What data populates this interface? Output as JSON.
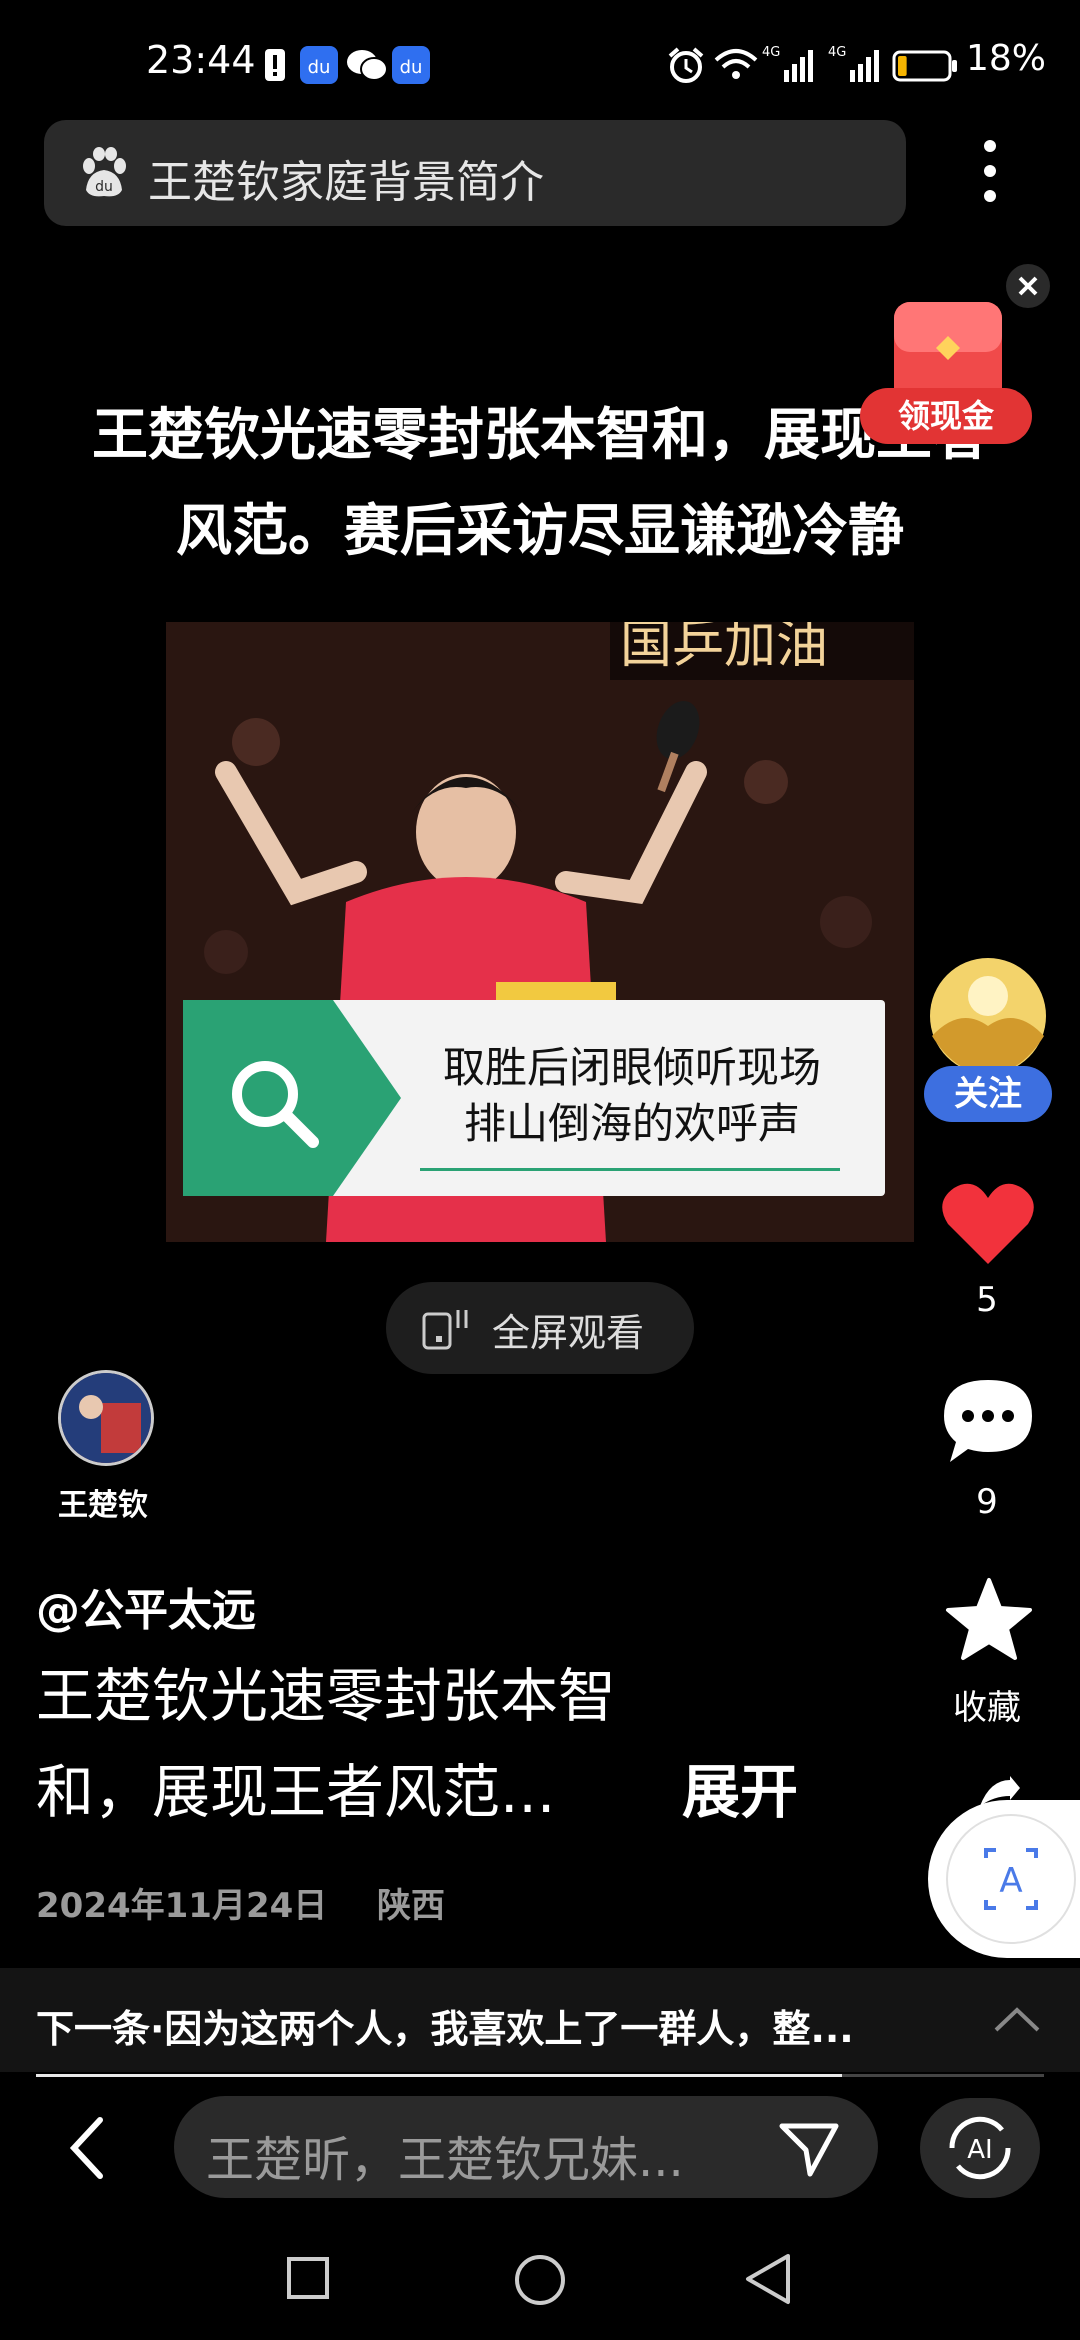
{
  "status_bar": {
    "time": "23:44",
    "battery_percent": "18%",
    "battery_level": 0.18,
    "icons": [
      "alert-icon",
      "baidu-app-icon",
      "wechat-icon",
      "baidu-app-icon",
      "alarm-icon",
      "wifi-icon",
      "signal-4g-icon",
      "signal-4g-icon",
      "battery-icon"
    ]
  },
  "search": {
    "query": "王楚钦家庭背景简介",
    "icon": "baidu-paw-icon"
  },
  "video": {
    "title_line1": "王楚钦光速零封张本智和，展现王者",
    "title_line2": "风范。赛后采访尽显谦逊冷静",
    "banner_text": "国乒加油",
    "caption_line1": "取胜后闭眼倾听现场",
    "caption_line2": "排山倒海的欢呼声",
    "fullscreen_label": "全屏观看"
  },
  "reward": {
    "label": "领现金"
  },
  "rail": {
    "follow_label": "关注",
    "like_count": "5",
    "comment_count": "9",
    "collect_label": "收藏"
  },
  "author": {
    "name": "王楚钦"
  },
  "post": {
    "handle": "@公平太远",
    "desc_line1": "王楚钦光速零封张本智",
    "desc_line2": "和，展现王者风范...",
    "expand_label": "展开",
    "date": "2024年11月24日",
    "location": "陕西"
  },
  "next": {
    "text": "下一条·因为这两个人，我喜欢上了一群人，整...",
    "progress": 0.8
  },
  "bottom": {
    "query": "王楚昕，王楚钦兄妹..."
  },
  "colors": {
    "accent_blue": "#3d6fe0",
    "like_red": "#f2323c",
    "reward_red": "#e83a3a",
    "caption_green": "#2aa274"
  }
}
